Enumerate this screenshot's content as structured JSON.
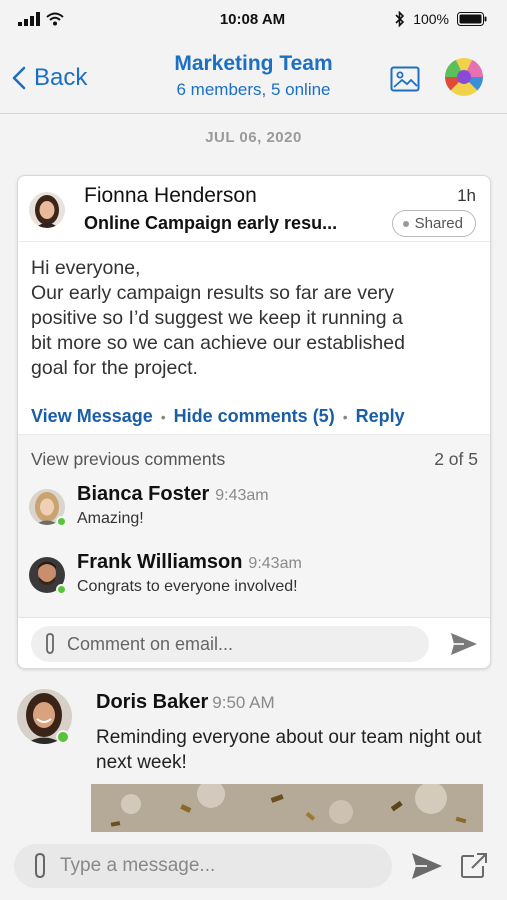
{
  "status": {
    "time": "10:08 AM",
    "battery": "100%"
  },
  "header": {
    "back_label": "Back",
    "title": "Marketing Team",
    "subtitle": "6 members, 5 online"
  },
  "date_divider": "JUL 06, 2020",
  "email": {
    "sender": "Fionna Henderson",
    "subject": "Online Campaign early resu...",
    "time_ago": "1h",
    "badge": "Shared",
    "body_lines": [
      "Hi everyone,",
      "Our early campaign results so far are very",
      "positive so I’d suggest we keep it running a",
      "bit more so we can achieve our established",
      "goal for the project."
    ],
    "actions": {
      "view": "View Message",
      "hide": "Hide comments (5)",
      "reply": "Reply"
    },
    "comments": {
      "previous_label": "View previous comments",
      "count": "2 of 5",
      "items": [
        {
          "name": "Bianca Foster",
          "time": "9:43am",
          "text": "Amazing!"
        },
        {
          "name": "Frank Williamson",
          "time": "9:43am",
          "text": "Congrats to everyone involved!"
        }
      ],
      "input_placeholder": "Comment on email..."
    }
  },
  "message": {
    "name": "Doris Baker",
    "time": "9:50 AM",
    "text": "Reminding everyone about our team night out next week!"
  },
  "composer": {
    "placeholder": "Type a message..."
  },
  "colors": {
    "accent": "#1c6fc2",
    "link": "#1a5ea8",
    "online": "#58c43b"
  },
  "icons": [
    "signal-icon",
    "wifi-icon",
    "bluetooth-icon",
    "battery-icon",
    "back-chevron-icon",
    "image-icon",
    "paperclip-icon",
    "send-icon",
    "open-external-icon"
  ]
}
